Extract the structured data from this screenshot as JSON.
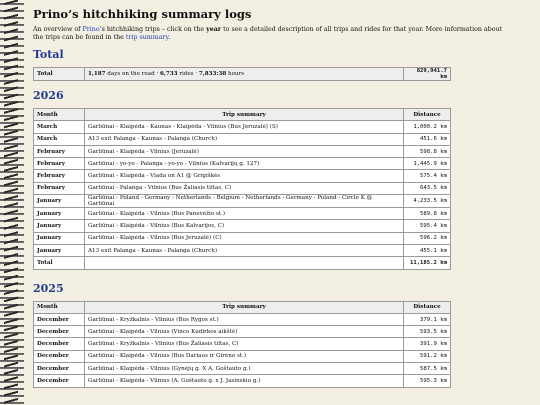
{
  "page": {
    "title": "Prino’s hitchhiking summary logs",
    "intro_before_link": "An overview of ",
    "intro_link_prino": "Prino",
    "intro_mid": "’s hitchhiking trips – click on the ",
    "intro_bold": "year",
    "intro_after": " to see a detailed description of all trips and rides for that year. More information about the trips can be found in the ",
    "intro_link_summary": "trip summary",
    "intro_end": "."
  },
  "total_section": {
    "heading": "Total",
    "label": "Total",
    "days": "1,187",
    "days_text": " days on the road · ",
    "rides": "6,733",
    "rides_text": " rides · ",
    "hours": "7,833:38",
    "hours_text": " hours",
    "distance": "829,941.7 km"
  },
  "table_headers": {
    "month": "Month",
    "summary": "Trip summary",
    "distance": "Distance"
  },
  "y2026": {
    "heading": "2026",
    "rows": [
      {
        "month": "March",
        "summary": "Garliūnai - Klaipėda - Kaunas - Klaipėda - Vilnius (Bus Jeruzalė) (S)",
        "distance": "1,000.2 km"
      },
      {
        "month": "March",
        "summary": "A13 exit Palanga - Kaunas - Palanga (Church)",
        "distance": "451.6 km"
      },
      {
        "month": "February",
        "summary": "Garliūnai - Klaipėda - Vilnius (Jeruzalė)",
        "distance": "598.8 km"
      },
      {
        "month": "February",
        "summary": "Garliūnai - yo-yo - Palanga - yo-yo - Vilnius (Kalvarijų g. 127)",
        "distance": "1,445.9 km"
      },
      {
        "month": "February",
        "summary": "Garliūnai - Klaipėda - Viada on A1 @ Grigiškės",
        "distance": "575.4 km"
      },
      {
        "month": "February",
        "summary": "Garliūnai - Palanga - Vilnius (Bus Žaliasis tiltas, C)",
        "distance": "643.5 km"
      },
      {
        "month": "January",
        "summary": "Garliūnai - Poland - Germany - Netherlands - Belgium - Netherlands - Germany - Poland - Circle K @ Garliūnai",
        "distance": "4,233.5 km"
      },
      {
        "month": "January",
        "summary": "Garliūnai - Klaipėda - Vilnius (Bus Panevėžio st.)",
        "distance": "589.8 km"
      },
      {
        "month": "January",
        "summary": "Garliūnai - Klaipėda - Vilnius (Bus Kalvarijos, C)",
        "distance": "595.4 km"
      },
      {
        "month": "January",
        "summary": "Garliūnai - Klaipėda - Vilnius (Bus Jeruzalė) (C)",
        "distance": "596.2 km"
      },
      {
        "month": "January",
        "summary": "A13 exit Palanga - Kaunas - Palanga (Church)",
        "distance": "455.1 km"
      }
    ],
    "total_label": "Total",
    "total_distance": "11,185.2 km"
  },
  "y2025": {
    "heading": "2025",
    "rows": [
      {
        "month": "December",
        "summary": "Garliūnai - Kryžkalnis - Vilnius (Bus Rygos st.)",
        "distance": "379.1 km"
      },
      {
        "month": "December",
        "summary": "Garliūnai - Klaipėda - Vilnius (Vinco Kudirkos aikštė)",
        "distance": "593.5 km"
      },
      {
        "month": "December",
        "summary": "Garliūnai - Kryžkalnis - Vilnius (Bus Žaliasis tiltas, C)",
        "distance": "391.9 km"
      },
      {
        "month": "December",
        "summary": "Garliūnai - Klaipėda - Vilnius (Bus Dariaus ir Girėno st.)",
        "distance": "591.2 km"
      },
      {
        "month": "December",
        "summary": "Garliūnai - Klaipėda - Vilnius (Gynėjų g. X A. Goštauto g.)",
        "distance": "587.5 km"
      },
      {
        "month": "December",
        "summary": "Garliūnai - Klaipėda - Vilnius (A. Goštauto g. x J. Jasinskio g.)",
        "distance": "595.3 km"
      }
    ]
  }
}
